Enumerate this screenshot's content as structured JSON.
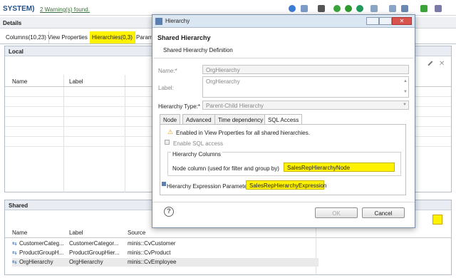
{
  "topbar": {
    "system": "SYSTEM)",
    "warning": "2 Warning(s) found."
  },
  "details": {
    "title": "Details"
  },
  "tabs": [
    {
      "label": "Columns(10,23)"
    },
    {
      "label": "View Properties"
    },
    {
      "label": "Hierarchies(0,3)"
    },
    {
      "label": "Param"
    }
  ],
  "local": {
    "title": "Local",
    "headers": {
      "name": "Name",
      "label": "Label"
    }
  },
  "shared": {
    "title": "Shared",
    "headers": {
      "name": "Name",
      "label": "Label",
      "source": "Source"
    },
    "rows": [
      {
        "name": "CustomerCateg...",
        "label": "CustomerCategor...",
        "source": "minis::CvCustomer"
      },
      {
        "name": "ProductGroupH...",
        "label": "ProductGroupHier...",
        "source": "minis::CvProduct"
      },
      {
        "name": "OrgHierarchy",
        "label": "OrgHierarchy",
        "source": "minis::CvEmployee"
      }
    ]
  },
  "dialog": {
    "window_title": "Hierarchy",
    "heading": "Shared Hierarchy",
    "subheading": "Shared Hierarchy Definition",
    "name_label": "Name:*",
    "name_value": "OrgHierarchy",
    "label_label": "Label:",
    "label_value": "OrgHierarchy",
    "type_label": "Hierarchy Type:*",
    "type_value": "Parent-Child Hierarchy",
    "tabs": [
      {
        "label": "Node"
      },
      {
        "label": "Advanced"
      },
      {
        "label": "Time dependency"
      },
      {
        "label": "SQL Access"
      }
    ],
    "info_text": "Enabled in View Properties for all shared hierarchies.",
    "enable_sql": "Enable SQL access",
    "columns_group": "Hierarchy Columns",
    "node_column_label": "Node column (used for filter and group by)",
    "node_column_value": "SalesRepHierarchyNode",
    "expr_label": "Hierarchy Expression Parameter",
    "expr_value": "SalesRepHierarchyExpression",
    "ok": "OK",
    "cancel": "Cancel"
  },
  "colors": {
    "highlight": "#fff200",
    "accent": "#1f4f8a"
  }
}
